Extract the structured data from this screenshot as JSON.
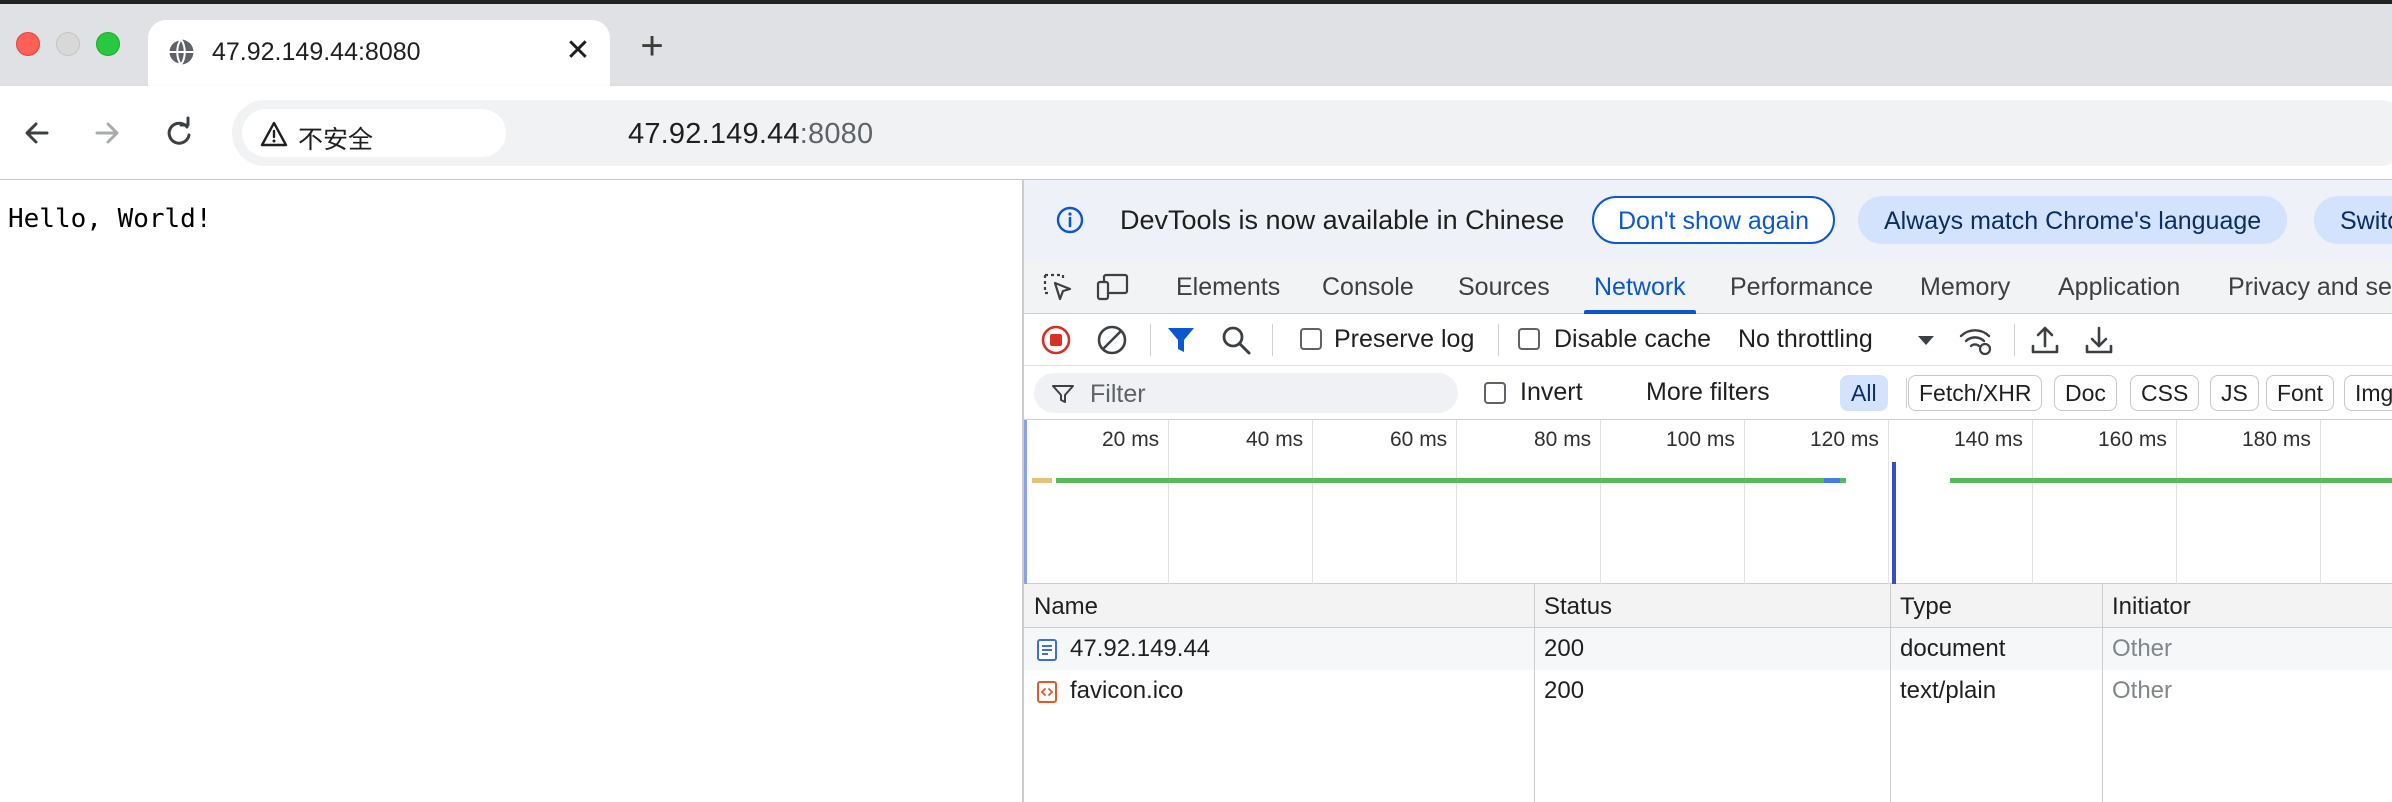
{
  "browser": {
    "tab": {
      "title": "47.92.149.44:8080",
      "close_glyph": "✕",
      "favicon": "globe-icon"
    },
    "new_tab_glyph": "+",
    "omnibox": {
      "security_label": "不安全",
      "url_host": "47.92.149.44",
      "url_port": ":8080"
    }
  },
  "page": {
    "text": "Hello, World!"
  },
  "devtools": {
    "infobar": {
      "message": "DevTools is now available in Chinese",
      "dont_show": "Don't show again",
      "always_match": "Always match Chrome's language",
      "switch": "Switc"
    },
    "tabs": [
      "Elements",
      "Console",
      "Sources",
      "Network",
      "Performance",
      "Memory",
      "Application",
      "Privacy and se"
    ],
    "active_tab": "Network",
    "toolbar": {
      "preserve_log": "Preserve log",
      "disable_cache": "Disable cache",
      "throttling": "No throttling"
    },
    "filter": {
      "placeholder": "Filter",
      "invert": "Invert",
      "more_filters": "More filters",
      "chips": [
        "All",
        "Fetch/XHR",
        "Doc",
        "CSS",
        "JS",
        "Font",
        "Img"
      ],
      "active_chip": "All"
    },
    "overview": {
      "ticks": [
        "20 ms",
        "40 ms",
        "60 ms",
        "80 ms",
        "100 ms",
        "120 ms",
        "140 ms",
        "160 ms",
        "180 ms"
      ],
      "colors": {
        "waiting": "#5bb85d",
        "download": "#4a7ae8",
        "load_marker": "#3b4fb8"
      }
    },
    "table": {
      "columns": [
        "Name",
        "Status",
        "Type",
        "Initiator"
      ],
      "rows": [
        {
          "name": "47.92.149.44",
          "status": "200",
          "type": "document",
          "initiator": "Other",
          "icon": "document-icon"
        },
        {
          "name": "favicon.ico",
          "status": "200",
          "type": "text/plain",
          "initiator": "Other",
          "icon": "script-file-icon"
        }
      ]
    }
  }
}
